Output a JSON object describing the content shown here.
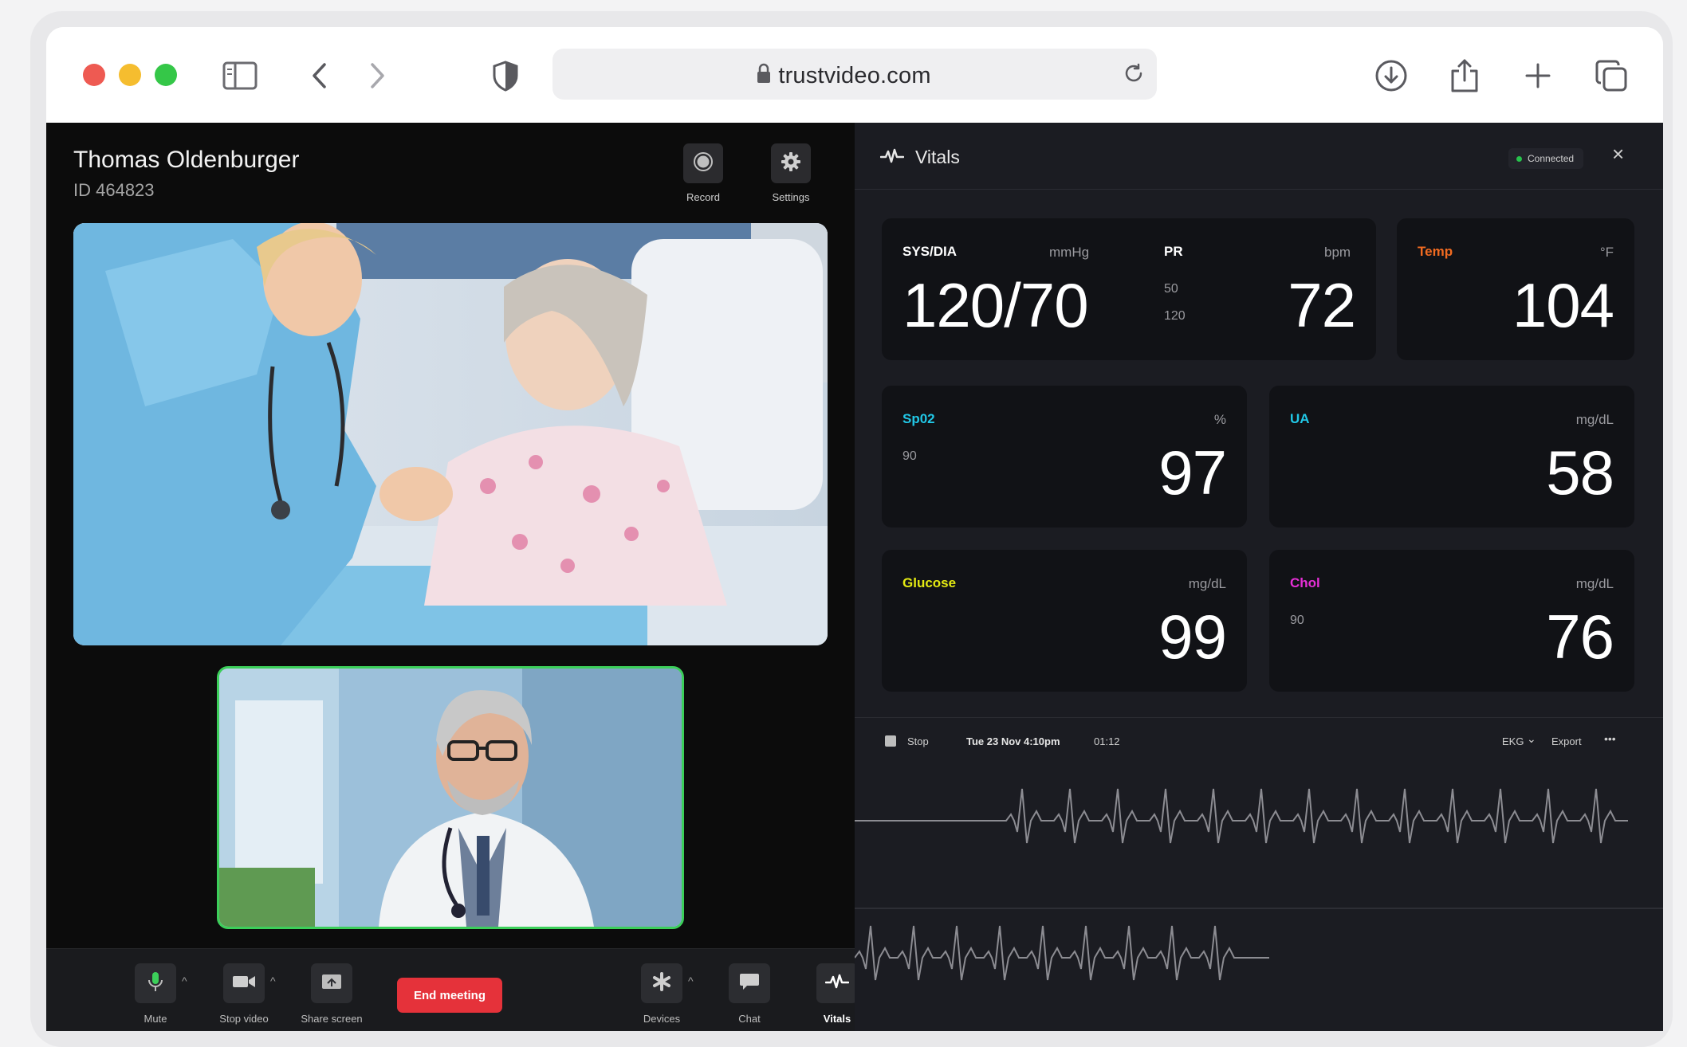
{
  "browser": {
    "url": "trustvideo.com"
  },
  "patient": {
    "name": "Thomas Oldenburger",
    "id": "ID 464823"
  },
  "top_controls": {
    "record": "Record",
    "settings": "Settings"
  },
  "bottom_controls": {
    "mute": "Mute",
    "stop_video": "Stop video",
    "share_screen": "Share screen",
    "end_meeting": "End meeting",
    "devices": "Devices",
    "chat": "Chat",
    "vitals": "Vitals"
  },
  "vitals_panel": {
    "title": "Vitals",
    "status": "Connected"
  },
  "vitals": {
    "sysdia": {
      "label": "SYS/DIA",
      "unit": "mmHg",
      "value": "120/70",
      "color": "#ffffff"
    },
    "pr": {
      "label": "PR",
      "unit": "bpm",
      "value": "72",
      "low": "50",
      "high": "120",
      "color": "#ffffff"
    },
    "temp": {
      "label": "Temp",
      "unit": "°F",
      "value": "104",
      "color": "#f26b21"
    },
    "spo2": {
      "label": "Sp02",
      "unit": "%",
      "value": "97",
      "low": "90",
      "color": "#21c7e6"
    },
    "ua": {
      "label": "UA",
      "unit": "mg/dL",
      "value": "58",
      "color": "#21c7e6"
    },
    "glucose": {
      "label": "Glucose",
      "unit": "mg/dL",
      "value": "99",
      "color": "#e4ea12"
    },
    "chol": {
      "label": "Chol",
      "unit": "mg/dL",
      "value": "76",
      "low": "90",
      "color": "#e62fd6"
    }
  },
  "recording": {
    "stop": "Stop",
    "datetime": "Tue 23 Nov 4:10pm",
    "elapsed": "01:12",
    "mode": "EKG",
    "export": "Export",
    "more": "•••"
  },
  "colors": {
    "connected": "#27c24c",
    "end_meeting": "#e5323a",
    "self_view_border": "#3ccf5a"
  }
}
